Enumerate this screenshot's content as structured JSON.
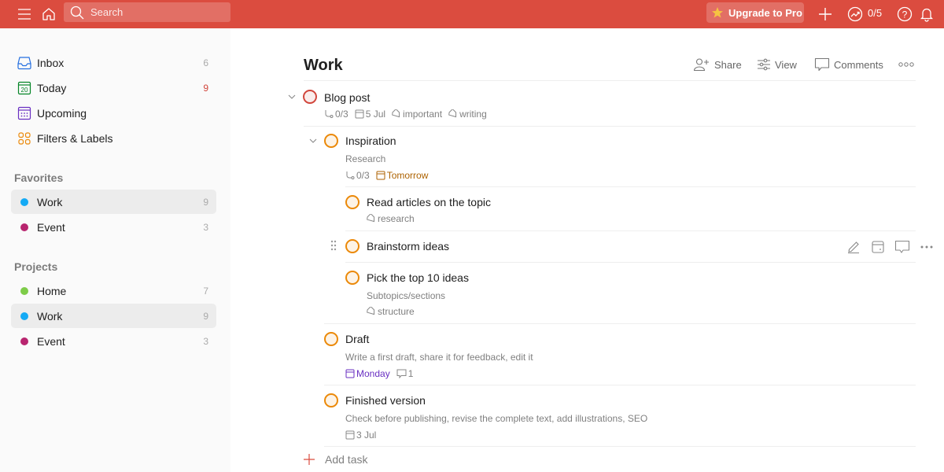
{
  "topbar": {
    "search_placeholder": "Search",
    "upgrade_label": "Upgrade to Pro",
    "karma": "0/5",
    "icons": [
      "menu-icon",
      "home-icon",
      "search-icon",
      "star-icon",
      "plus-icon",
      "karma-icon",
      "help-icon",
      "bell-icon"
    ]
  },
  "sidebar": {
    "nav": [
      {
        "label": "Inbox",
        "count": "6",
        "icon": "inbox-icon",
        "color": "#246fe0"
      },
      {
        "label": "Today",
        "count": "9",
        "icon": "calendar-today-icon",
        "color": "#058527",
        "day": "20"
      },
      {
        "label": "Upcoming",
        "count": "",
        "icon": "calendar-upcoming-icon",
        "color": "#692fc2"
      },
      {
        "label": "Filters & Labels",
        "count": "",
        "icon": "filters-icon",
        "color": "#eb8909"
      }
    ],
    "favorites_title": "Favorites",
    "favorites": [
      {
        "label": "Work",
        "count": "9",
        "color": "#14aaf5",
        "active": true
      },
      {
        "label": "Event",
        "count": "3",
        "color": "#b8256f",
        "active": false
      }
    ],
    "projects_title": "Projects",
    "projects": [
      {
        "label": "Home",
        "count": "7",
        "color": "#7ecc49",
        "active": false
      },
      {
        "label": "Work",
        "count": "9",
        "color": "#14aaf5",
        "active": true
      },
      {
        "label": "Event",
        "count": "3",
        "color": "#b8256f",
        "active": false
      }
    ]
  },
  "main": {
    "title": "Work",
    "actions": {
      "share": "Share",
      "view": "View",
      "comments": "Comments"
    },
    "tasks": [
      {
        "name": "Blog post",
        "subtasks": "0/3",
        "date": "5 Jul",
        "labels": [
          "important",
          "writing"
        ]
      },
      {
        "name": "Inspiration",
        "description": "Research",
        "subtasks": "0/3",
        "date": "Tomorrow"
      },
      {
        "name": "Read articles on the topic",
        "labels": [
          "research"
        ]
      },
      {
        "name": "Brainstorm ideas"
      },
      {
        "name": "Pick the top 10 ideas",
        "description": "Subtopics/sections",
        "labels": [
          "structure"
        ]
      },
      {
        "name": "Draft",
        "description": "Write a first draft, share it for feedback, edit it",
        "date": "Monday",
        "comments": "1"
      },
      {
        "name": "Finished version",
        "description": "Check before publishing, revise the complete text, add illustrations, SEO",
        "date": "3 Jul"
      }
    ],
    "add_task_label": "Add task"
  }
}
